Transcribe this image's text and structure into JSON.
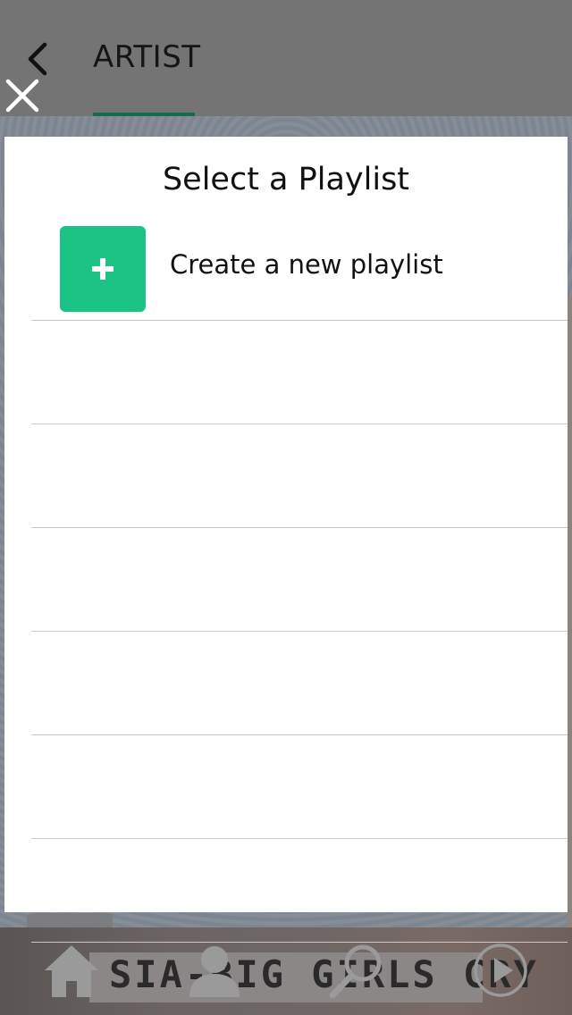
{
  "header": {
    "tab_label": "ARTIST"
  },
  "modal": {
    "title": "Select a Playlist",
    "create_label": "Create a new playlist",
    "playlists": [
      "",
      "",
      "",
      "",
      "",
      ""
    ]
  },
  "now_playing": {
    "banner_text": "SIA-BIG GIRLS CRY"
  },
  "nav": {
    "items": [
      "home-icon",
      "profile-icon",
      "search-icon",
      "play-icon"
    ]
  },
  "colors": {
    "accent": "#1bc485",
    "tab_underline": "#176a4c",
    "overlay_bg": "#747474"
  }
}
